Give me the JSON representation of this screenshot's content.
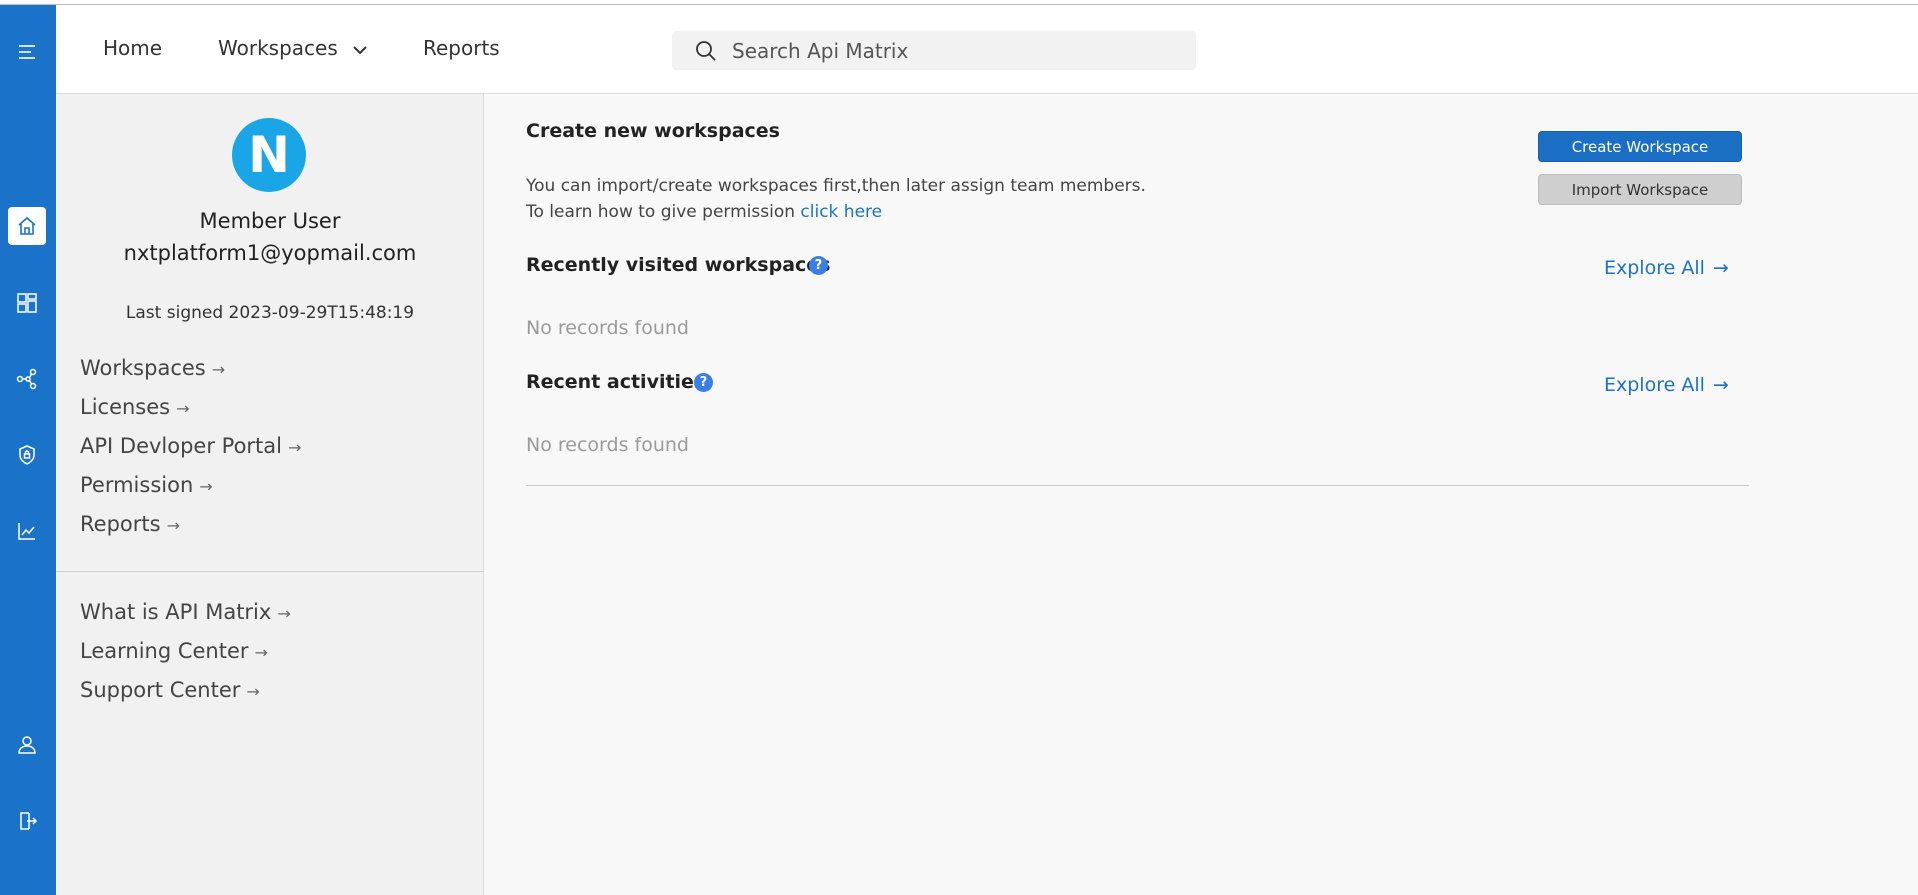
{
  "header": {
    "nav": {
      "home": "Home",
      "workspaces": "Workspaces",
      "reports": "Reports"
    },
    "search_placeholder": "Search Api Matrix"
  },
  "rail": {
    "icons": [
      "menu-icon",
      "home-icon",
      "dashboard-icon",
      "share-nodes-icon",
      "shield-icon",
      "analytics-chart-icon",
      "user-icon",
      "logout-icon"
    ],
    "accent": "#1a73c9"
  },
  "profile": {
    "avatar_letter": "N",
    "name": "Member User",
    "email": "nxtplatform1@yopmail.com",
    "last_signed": "Last signed 2023-09-29T15:48:19",
    "links": [
      "Workspaces",
      "Licenses",
      "API Devloper Portal",
      "Permission",
      "Reports"
    ],
    "help_links": [
      "What is API Matrix",
      "Learning Center",
      "Support Center"
    ],
    "arrow": "→"
  },
  "main": {
    "create_title": "Create new workspaces",
    "create_desc_line1": "You can import/create workspaces first,then later assign team members.",
    "create_desc_line2": "To learn how to give permission",
    "create_link": "click here",
    "create_button": "Create Workspace",
    "import_button": "Import Workspace",
    "recent_workspaces_title": "Recently visited workspaces",
    "recent_activities_title": "Recent activities",
    "help_mark": "?",
    "explore_all": "Explore All",
    "explore_arrow": "→",
    "no_records": "No records found"
  }
}
